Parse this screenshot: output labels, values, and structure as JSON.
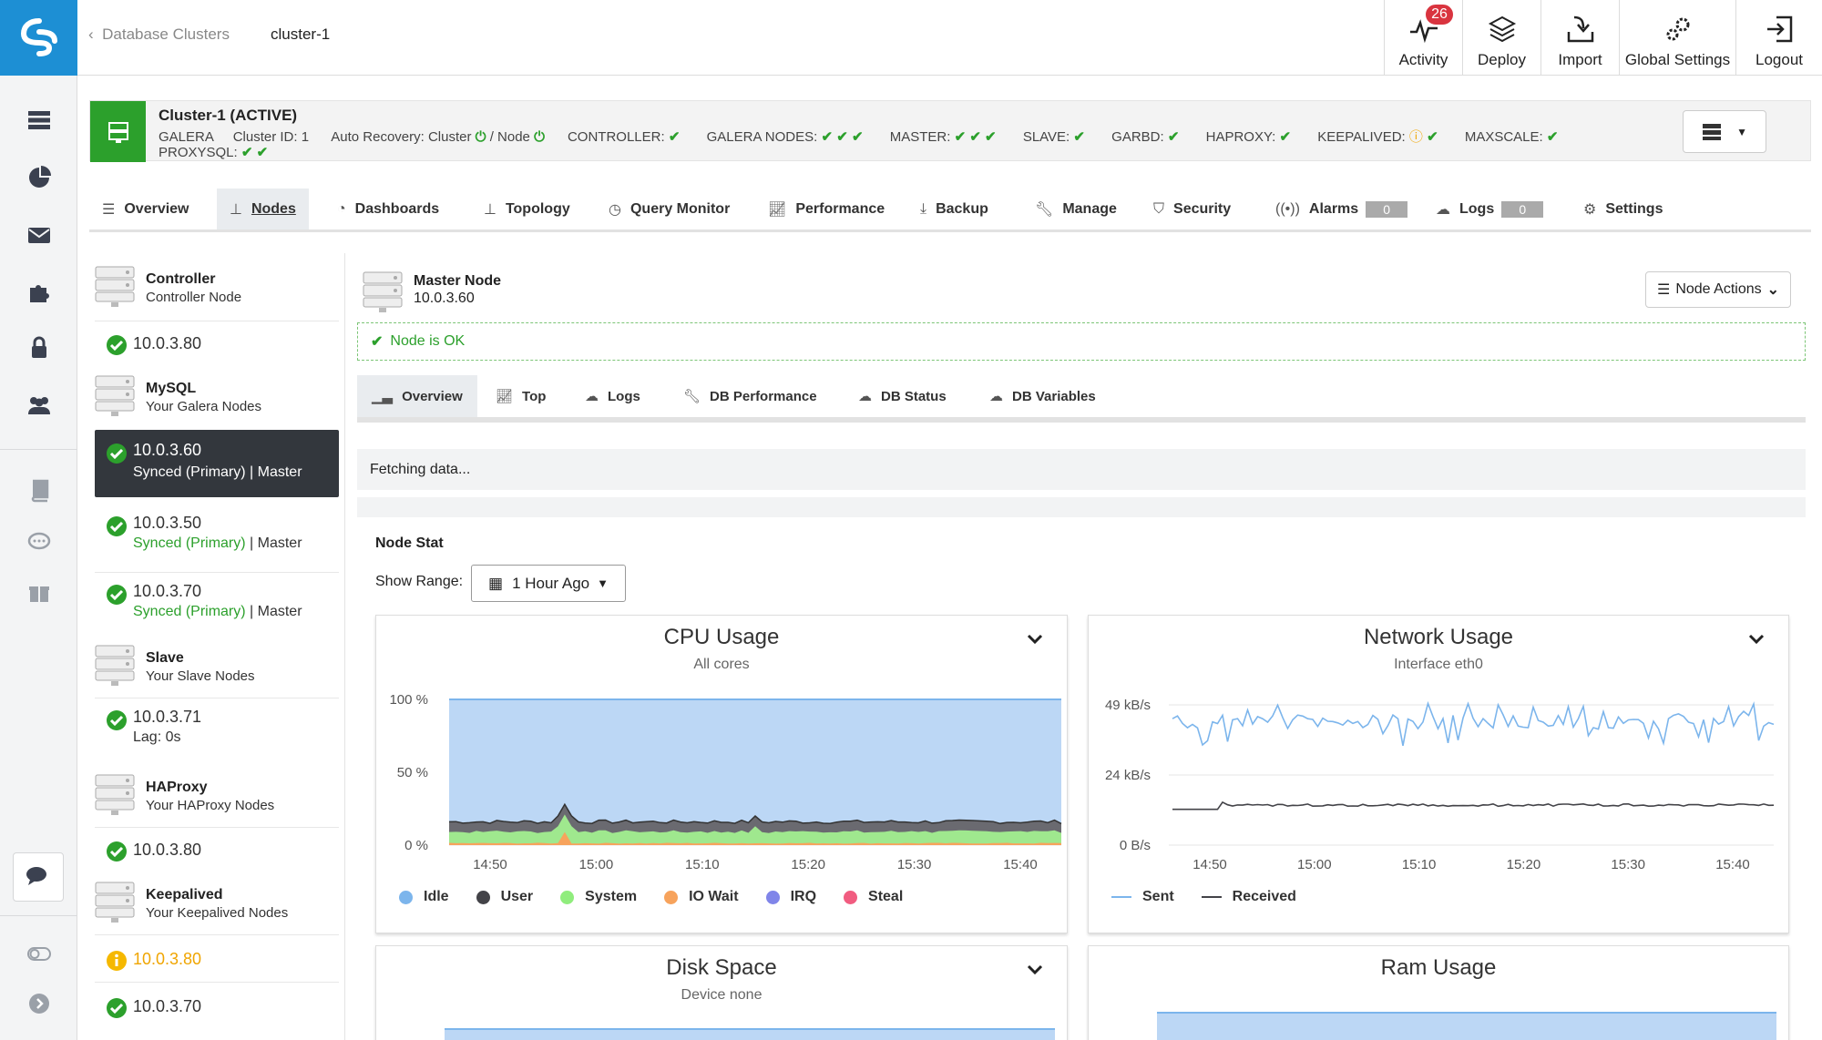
{
  "breadcrumb": {
    "back": "Database Clusters",
    "current": "cluster-1"
  },
  "toolbar": {
    "activity": "Activity",
    "activity_count": "26",
    "deploy": "Deploy",
    "import": "Import",
    "global_settings": "Global Settings",
    "logout": "Logout"
  },
  "cluster": {
    "title": "Cluster-1 (ACTIVE)",
    "type": "GALERA",
    "cluster_id": "Cluster ID: 1",
    "auto_recovery": "Auto Recovery: Cluster",
    "node_sep": "/ Node",
    "controller": "CONTROLLER:",
    "galera_nodes": "GALERA NODES:",
    "master": "MASTER:",
    "slave": "SLAVE:",
    "garbd": "GARBD:",
    "haproxy": "HAPROXY:",
    "keepalived": "KEEPALIVED:",
    "maxscale": "MAXSCALE:",
    "proxysql": "PROXYSQL:"
  },
  "tabs": {
    "overview": "Overview",
    "nodes": "Nodes",
    "dashboards": "Dashboards",
    "topology": "Topology",
    "query_monitor": "Query Monitor",
    "performance": "Performance",
    "backup": "Backup",
    "manage": "Manage",
    "security": "Security",
    "alarms": "Alarms",
    "alarms_count": "0",
    "logs": "Logs",
    "logs_count": "0",
    "settings": "Settings"
  },
  "nodes": {
    "controller": {
      "title": "Controller",
      "sub": "Controller Node",
      "ip": "10.0.3.80"
    },
    "mysql": {
      "title": "MySQL",
      "sub": "Your Galera Nodes"
    },
    "mysql_nodes": [
      {
        "ip": "10.0.3.60",
        "state": "Synced (Primary)",
        "role": "| Master"
      },
      {
        "ip": "10.0.3.50",
        "state": "Synced (Primary)",
        "role": "| Master"
      },
      {
        "ip": "10.0.3.70",
        "state": "Synced (Primary)",
        "role": "| Master"
      }
    ],
    "slave": {
      "title": "Slave",
      "sub": "Your Slave Nodes",
      "ip": "10.0.3.71",
      "lag": "Lag: 0s"
    },
    "haproxy": {
      "title": "HAProxy",
      "sub": "Your HAProxy Nodes",
      "ip": "10.0.3.80"
    },
    "keepalived": {
      "title": "Keepalived",
      "sub": "Your Keepalived Nodes",
      "ip1": "10.0.3.80",
      "ip2": "10.0.3.70"
    }
  },
  "detail": {
    "title": "Master Node",
    "ip": "10.0.3.60",
    "node_actions": "Node Actions",
    "status": "Node is OK",
    "subtabs": {
      "overview": "Overview",
      "top": "Top",
      "logs": "Logs",
      "db_performance": "DB Performance",
      "db_status": "DB Status",
      "db_variables": "DB Variables"
    },
    "fetching": "Fetching data...",
    "node_stat": "Node Stat",
    "show_range": "Show Range:",
    "range_value": "1 Hour Ago"
  },
  "chart_data": [
    {
      "type": "area",
      "title": "CPU Usage",
      "subtitle": "All cores",
      "y_ticks": [
        "100 %",
        "50 %",
        "0 %"
      ],
      "ylim": [
        0,
        100
      ],
      "x_ticks": [
        "14:50",
        "15:00",
        "15:10",
        "15:20",
        "15:30",
        "15:40"
      ],
      "series": [
        {
          "name": "Idle",
          "color": "#7cb5ec",
          "level": 100
        },
        {
          "name": "User",
          "color": "#434348",
          "level": 16
        },
        {
          "name": "System",
          "color": "#90ed7d",
          "level": 9
        },
        {
          "name": "IO Wait",
          "color": "#f7a35c",
          "level": 1
        },
        {
          "name": "IRQ",
          "color": "#8085e9",
          "level": 0
        },
        {
          "name": "Steal",
          "color": "#f15c80",
          "level": 0
        }
      ]
    },
    {
      "type": "line",
      "title": "Network Usage",
      "subtitle": "Interface eth0",
      "y_ticks": [
        "49 kB/s",
        "24 kB/s",
        "0 B/s"
      ],
      "ylim": [
        0,
        49
      ],
      "x_ticks": [
        "14:50",
        "15:00",
        "15:10",
        "15:20",
        "15:30",
        "15:40"
      ],
      "series": [
        {
          "name": "Sent",
          "color": "#7cb5ec",
          "level": 43
        },
        {
          "name": "Received",
          "color": "#434348",
          "level": 14
        }
      ]
    },
    {
      "type": "area",
      "title": "Disk Space",
      "subtitle": "Device none"
    },
    {
      "type": "area",
      "title": "Ram Usage"
    }
  ]
}
